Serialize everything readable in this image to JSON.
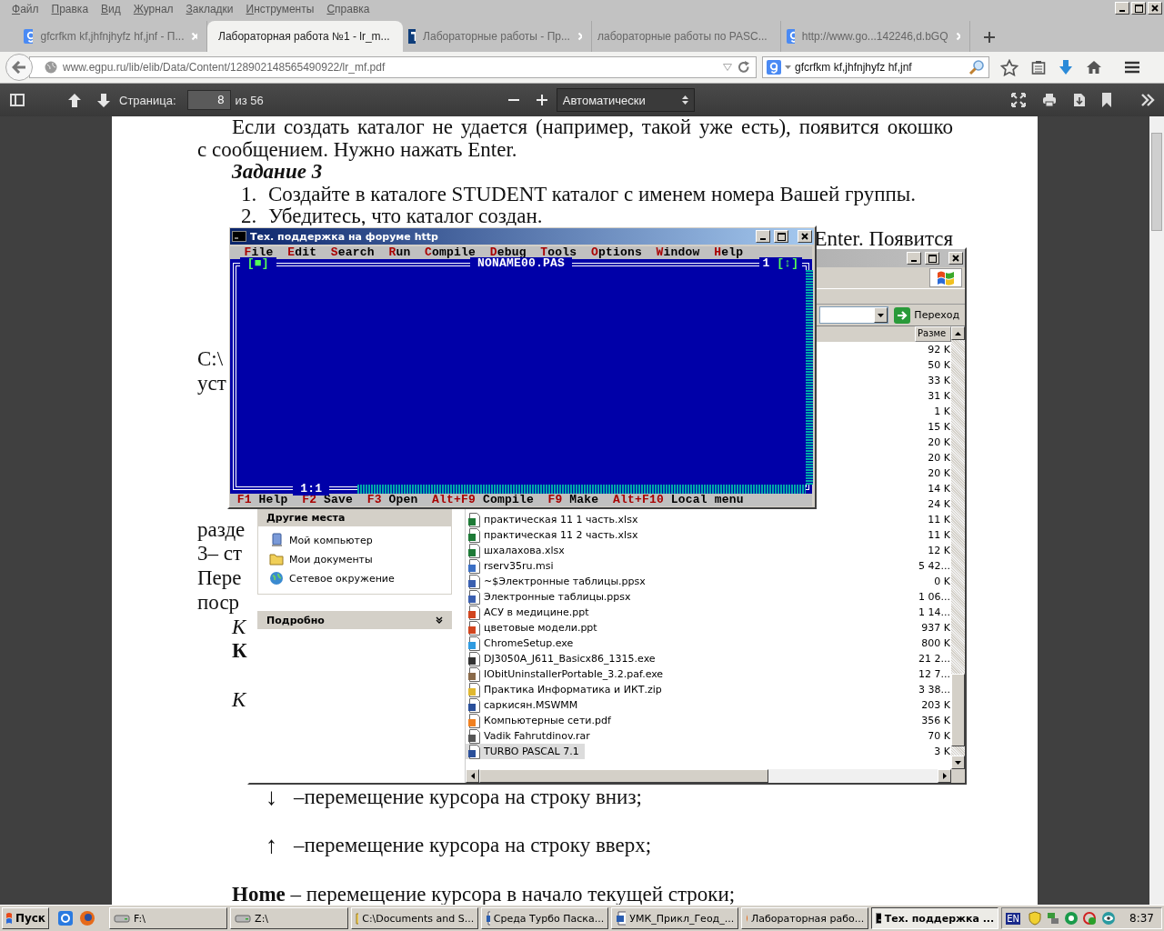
{
  "browser": {
    "menu": [
      "Файл",
      "Правка",
      "Вид",
      "Журнал",
      "Закладки",
      "Инструменты",
      "Справка"
    ],
    "tabs": [
      {
        "label": "gfcrfkm kf,jhfnjhyfz hf,jnf - П...",
        "selected": false
      },
      {
        "label": "Лабораторная работа №1 - lr_m...",
        "selected": true
      },
      {
        "label": "Лабораторные работы - Пр...",
        "selected": false
      },
      {
        "label": "лабораторные работы по PASC...",
        "selected": false
      },
      {
        "label": "http://www.go...142246,d.bGQ",
        "selected": false
      }
    ],
    "url": "www.egpu.ru/lib/elib/Data/Content/128902148565490922/lr_mf.pdf",
    "search_query": "gfcrfkm kf,jhfnjhyfz hf,jnf"
  },
  "pdf_toolbar": {
    "page_label": "Страница:",
    "page": "8",
    "page_count": "из 56",
    "zoom": "Автоматически"
  },
  "document": {
    "lines": [
      {
        "kind": "indent",
        "text": "Если создать каталог не удается (например, такой уже есть), появится окошко"
      },
      {
        "kind": "para",
        "text": "с сообщением. Нужно нажать Enter."
      },
      {
        "kind": "heading",
        "text": "Задание 3"
      },
      {
        "kind": "numbered",
        "number": "1.",
        "text": "Создайте в каталоге STUDENT каталог с именем номера Вашей группы."
      },
      {
        "kind": "numbered",
        "number": "2.",
        "text": "Убедитесь, что каталог создан."
      },
      {
        "kind": "right",
        "text": "Enter. Появится"
      },
      {
        "kind": "para",
        "text": "C:\\"
      },
      {
        "kind": "para",
        "text": "уст"
      },
      {
        "kind": "para",
        "text": "разде"
      },
      {
        "kind": "para",
        "text": "3– ст"
      },
      {
        "kind": "para",
        "text": "Пере"
      },
      {
        "kind": "para",
        "text": "поср"
      },
      {
        "kind": "italic",
        "text": "К"
      },
      {
        "kind": "bold",
        "text": "К"
      },
      {
        "kind": "italic",
        "text": "К"
      },
      {
        "kind": "arrow",
        "symbol": "↓",
        "text": "–перемещение курсора на строку вниз;"
      },
      {
        "kind": "arrow",
        "symbol": "↑",
        "text": "–перемещение курсора на строку вверх;"
      },
      {
        "kind": "rich",
        "text": "**Home** –  перемещение курсора в начало текущей строки;"
      }
    ]
  },
  "turbo_pascal": {
    "title": "Тех. поддержка на форуме http",
    "menu": [
      "File",
      "Edit",
      "Search",
      "Run",
      "Compile",
      "Debug",
      "Tools",
      "Options",
      "Window",
      "Help"
    ],
    "editor": {
      "file": "NONAME00.PAS",
      "close_box": "[■]",
      "window_number": "1",
      "zoom_box": "[↕]",
      "cursor": "1:1"
    },
    "status": [
      {
        "key": "F1",
        "label": "Help"
      },
      {
        "key": "F2",
        "label": "Save"
      },
      {
        "key": "F3",
        "label": "Open"
      },
      {
        "key": "Alt+F9",
        "label": "Compile"
      },
      {
        "key": "F9",
        "label": "Make"
      },
      {
        "key": "Alt+F10",
        "label": "Local menu"
      }
    ]
  },
  "explorer": {
    "go_button": "Переход",
    "size_header": "Разме",
    "sidebar_title": "Другие места",
    "places": [
      "Мой компьютер",
      "Мои документы",
      "Сетевое окружение"
    ],
    "details_title": "Подробно",
    "files": [
      {
        "size": "92 K",
        "selected": false
      },
      {
        "size": "50 K",
        "selected": false
      },
      {
        "size": "33 K",
        "selected": false
      },
      {
        "size": "31 K",
        "selected": false
      },
      {
        "size": "1 K",
        "selected": false
      },
      {
        "size": "15 K",
        "selected": false
      },
      {
        "size": "20 K",
        "selected": false
      },
      {
        "size": "20 K",
        "selected": false
      },
      {
        "size": "20 K",
        "selected": false
      },
      {
        "size": "14 K",
        "selected": false
      },
      {
        "size": "24 K",
        "selected": false
      },
      {
        "name": "практическая 11 1 часть.xlsx",
        "kind": "xlsx",
        "size": "11 K",
        "selected": false
      },
      {
        "name": "практическая 11 2 часть.xlsx",
        "kind": "xlsx",
        "size": "11 K",
        "selected": false
      },
      {
        "name": "шхалахова.xlsx",
        "kind": "xlsx",
        "size": "12 K",
        "selected": false
      },
      {
        "name": "rserv35ru.msi",
        "kind": "msi",
        "size": "5 42...",
        "selected": false
      },
      {
        "name": "~$Электронные таблицы.ppsx",
        "kind": "ppsx",
        "size": "0 K",
        "selected": false
      },
      {
        "name": "Электронные таблицы.ppsx",
        "kind": "ppsx",
        "size": "1 06...",
        "selected": false
      },
      {
        "name": "АСУ в медицине.ppt",
        "kind": "ppt",
        "size": "1 14...",
        "selected": false
      },
      {
        "name": "цветовые модели.ppt",
        "kind": "ppt",
        "size": "937 K",
        "selected": false
      },
      {
        "name": "ChromeSetup.exe",
        "kind": "setup",
        "size": "800 K",
        "selected": false
      },
      {
        "name": "DJ3050A_J611_Basicx86_1315.exe",
        "kind": "exe",
        "size": "21 2...",
        "selected": false
      },
      {
        "name": "IObitUninstallerPortable_3.2.paf.exe",
        "kind": "package",
        "size": "12 7...",
        "selected": false
      },
      {
        "name": "Практика Информатика и ИКТ.zip",
        "kind": "zip",
        "size": "3 38...",
        "selected": false
      },
      {
        "name": "саркисян.MSWMM",
        "kind": "movie",
        "size": "203 K",
        "selected": false
      },
      {
        "name": "Компьютерные сети.pdf",
        "kind": "pdf",
        "size": "356 K",
        "selected": false
      },
      {
        "name": "Vadik Fahrutdinov.rar",
        "kind": "rar",
        "size": "70 K",
        "selected": false
      },
      {
        "name": "TURBO PASCAL 7.1",
        "kind": "shortcut",
        "size": "3 K",
        "selected": true
      }
    ]
  },
  "taskbar": {
    "start": "Пуск",
    "tasks": [
      {
        "label": "F:\\",
        "selected": false
      },
      {
        "label": "Z:\\",
        "selected": false
      },
      {
        "label": "C:\\Documents and S...",
        "selected": false
      },
      {
        "label": "Среда Турбо Паска...",
        "selected": false
      },
      {
        "label": "УМК_Прикл_Геод_...",
        "selected": false
      },
      {
        "label": "Лабораторная рабо...",
        "selected": false
      },
      {
        "label": "Тех. поддержка ...",
        "selected": true
      }
    ],
    "language": "EN",
    "clock": "8:37"
  }
}
